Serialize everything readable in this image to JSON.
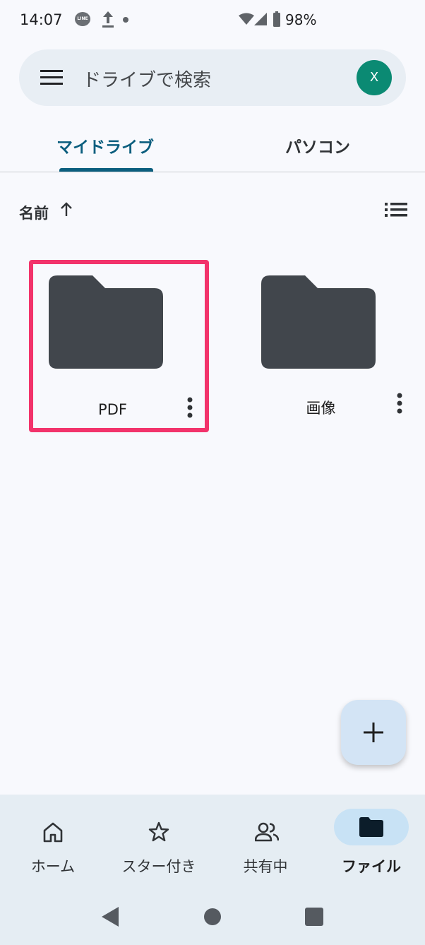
{
  "status_bar": {
    "time": "14:07",
    "line_badge": "LINE",
    "battery": "98%"
  },
  "search": {
    "placeholder": "ドライブで検索",
    "avatar_initial": "X",
    "avatar_color": "#0b8a73"
  },
  "tabs": [
    {
      "label": "マイドライブ",
      "selected": true
    },
    {
      "label": "パソコン",
      "selected": false
    }
  ],
  "sort": {
    "label": "名前",
    "direction": "ascending"
  },
  "folders": [
    {
      "name": "PDF",
      "highlighted": true
    },
    {
      "name": "画像",
      "highlighted": false
    }
  ],
  "bottom_nav": [
    {
      "label": "ホーム",
      "icon": "home-icon",
      "active": false
    },
    {
      "label": "スター付き",
      "icon": "star-icon",
      "active": false
    },
    {
      "label": "共有中",
      "icon": "people-icon",
      "active": false
    },
    {
      "label": "ファイル",
      "icon": "folder-icon",
      "active": true
    }
  ],
  "colors": {
    "accent": "#0b5e7e",
    "highlight_border": "#f2336b",
    "folder_fill": "#41464c"
  }
}
